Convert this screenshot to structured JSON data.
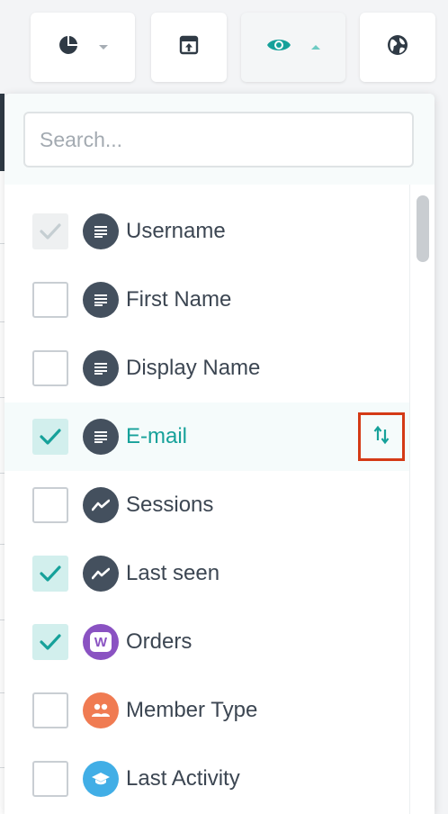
{
  "colors": {
    "accent": "#16a19a",
    "icon_dark": "#44505e",
    "orders_purple": "#8a52c2",
    "member_orange": "#f07b52",
    "activity_blue": "#41aee6",
    "highlight_border": "#d43a16"
  },
  "toolbar": {
    "buttons": [
      {
        "name": "chart-type",
        "icon": "pie-chart-icon",
        "dropdown": "chevron-down-icon"
      },
      {
        "name": "export",
        "icon": "export-icon"
      },
      {
        "name": "visibility",
        "icon": "eye-icon",
        "dropdown": "chevron-up-icon",
        "active": true
      },
      {
        "name": "globe",
        "icon": "globe-icon"
      }
    ]
  },
  "search": {
    "placeholder": "Search...",
    "value": ""
  },
  "columns": [
    {
      "label": "Username",
      "checked": true,
      "disabled": true,
      "icon": "text-lines-icon"
    },
    {
      "label": "First Name",
      "checked": false,
      "icon": "text-lines-icon"
    },
    {
      "label": "Display Name",
      "checked": false,
      "icon": "text-lines-icon"
    },
    {
      "label": "E-mail",
      "checked": true,
      "hovered": true,
      "icon": "text-lines-icon",
      "action_icon": "sort-arrows-icon"
    },
    {
      "label": "Sessions",
      "checked": false,
      "icon": "trend-line-icon"
    },
    {
      "label": "Last seen",
      "checked": true,
      "icon": "trend-line-icon"
    },
    {
      "label": "Orders",
      "checked": true,
      "icon": "woocommerce-icon",
      "icon_letter": "W"
    },
    {
      "label": "Member Type",
      "checked": false,
      "icon": "people-icon"
    },
    {
      "label": "Last Activity",
      "checked": false,
      "icon": "graduation-cap-icon"
    }
  ]
}
